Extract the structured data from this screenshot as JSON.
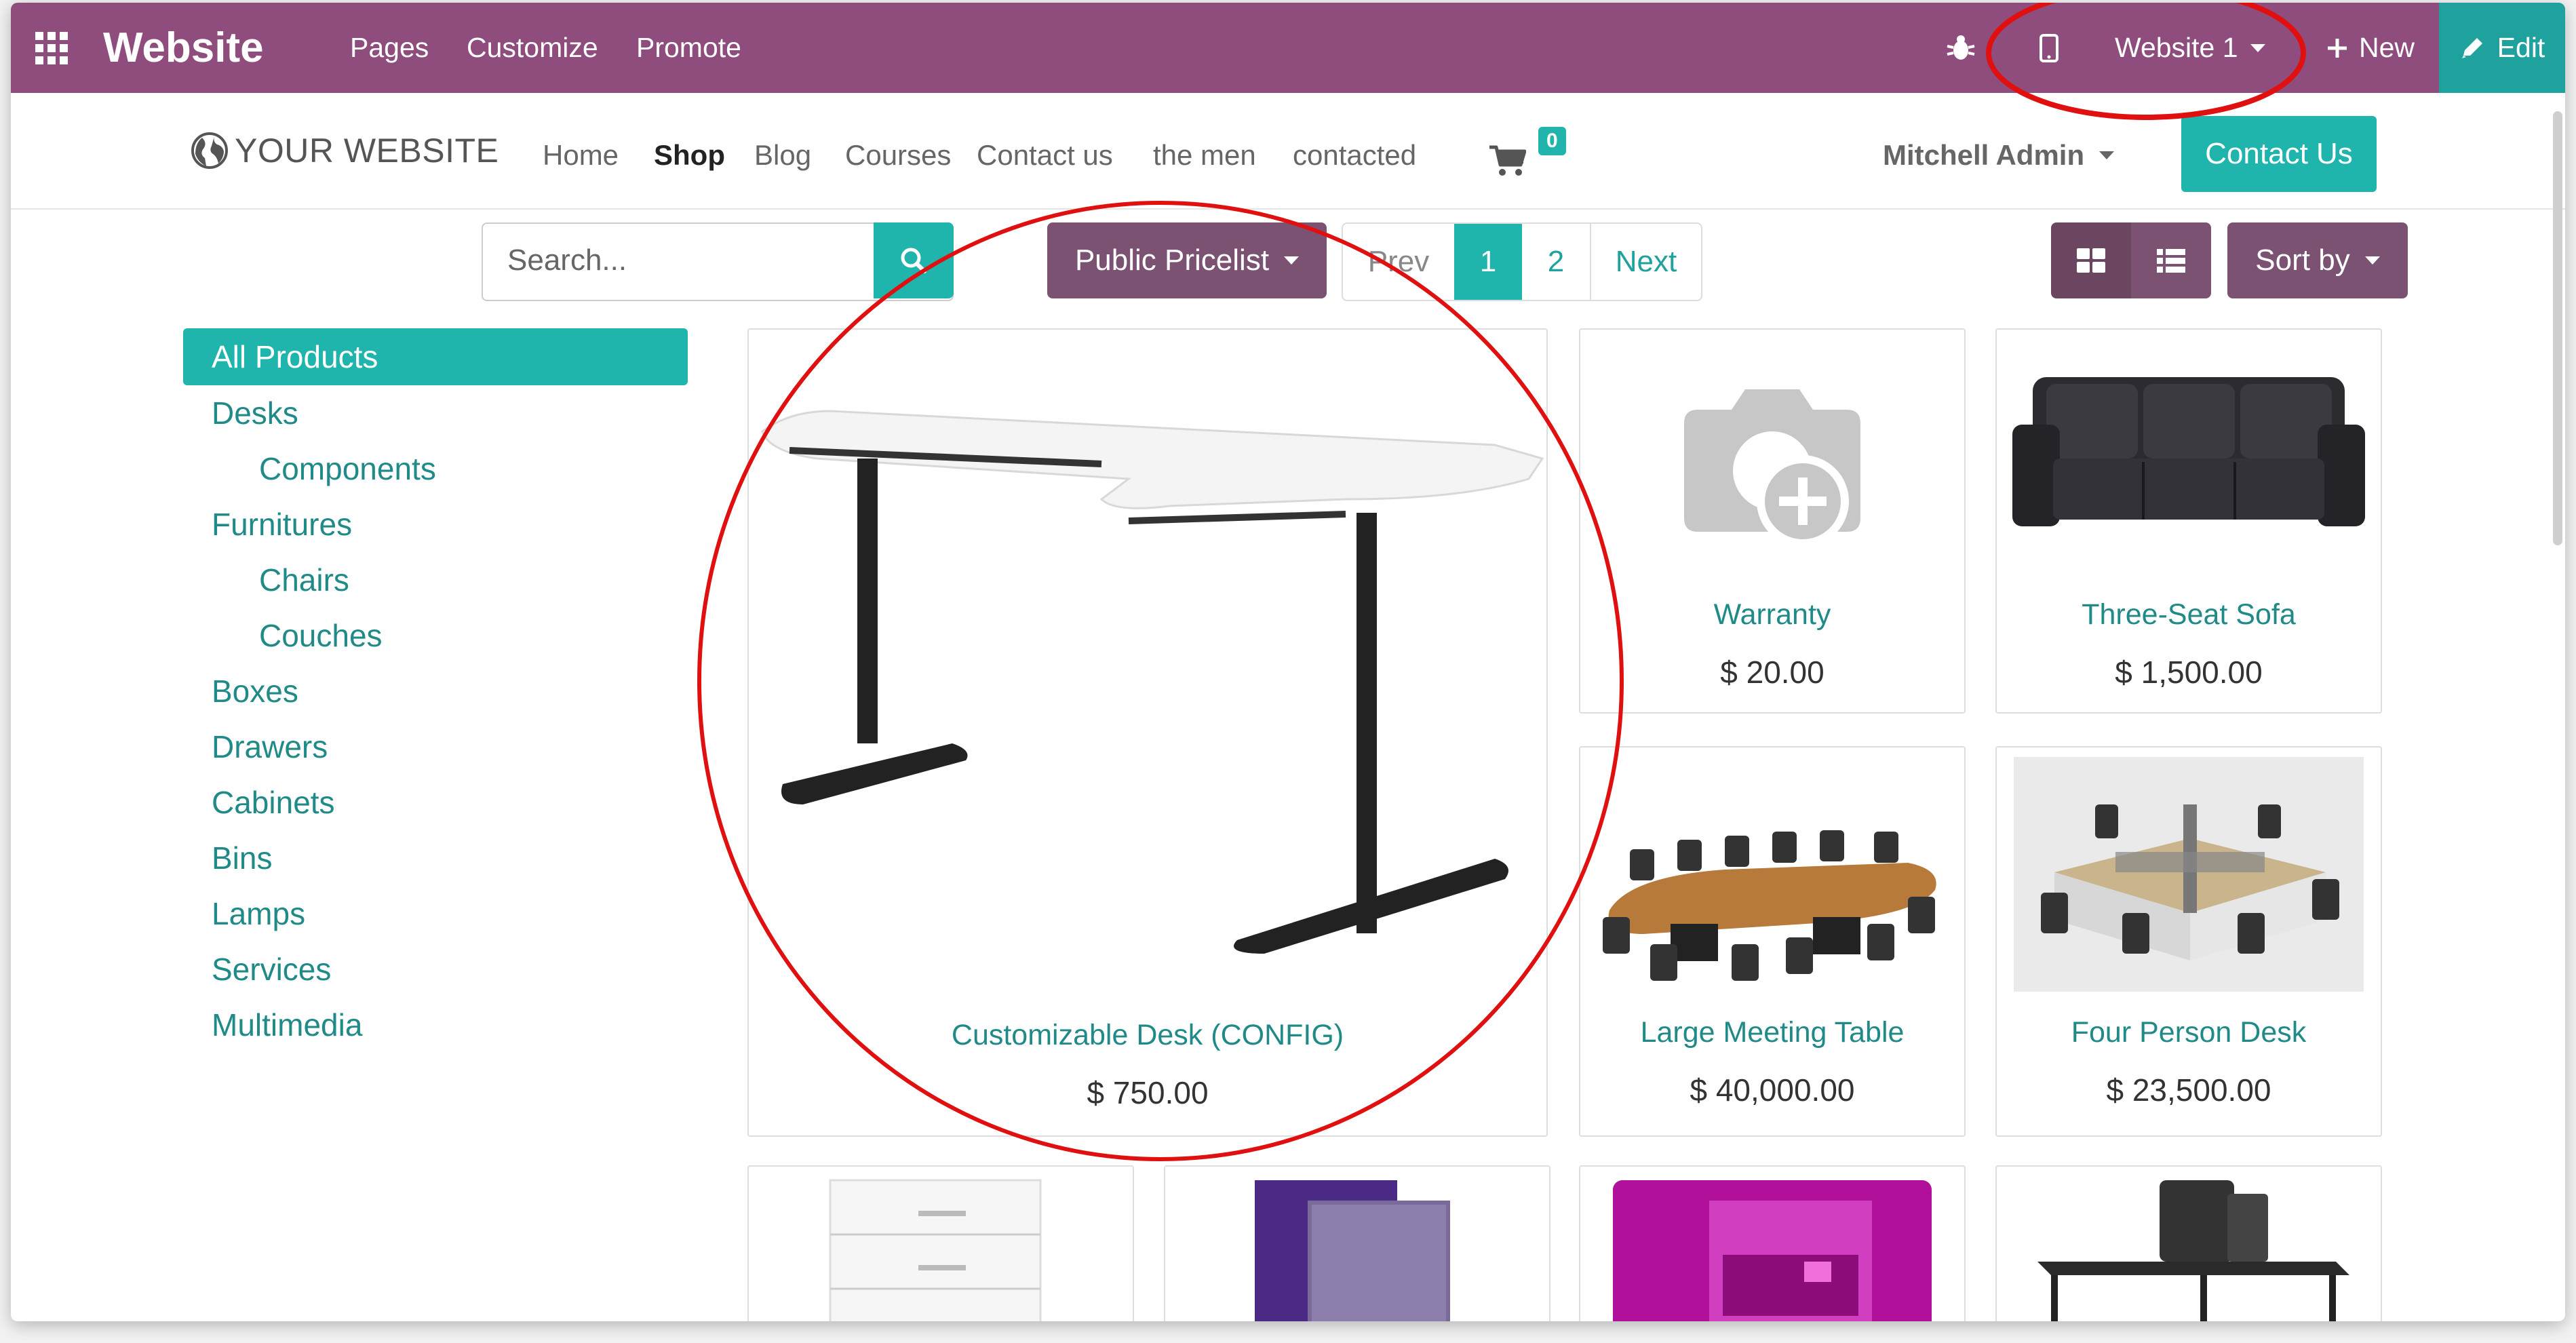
{
  "topbar": {
    "app_title": "Website",
    "menu": [
      "Pages",
      "Customize",
      "Promote"
    ],
    "website_selector": "Website 1",
    "new_label": "New",
    "edit_label": "Edit",
    "color": "#8e4d7c"
  },
  "site": {
    "logo_text": "YOUR WEBSITE",
    "nav": [
      "Home",
      "Shop",
      "Blog",
      "Courses",
      "Contact us",
      "the men",
      "contacted"
    ],
    "active_nav": "Shop",
    "cart_count": "0",
    "user": "Mitchell Admin",
    "contact_button": "Contact Us",
    "accent": "#1fb5ac"
  },
  "toolbar": {
    "search_placeholder": "Search...",
    "pricelist": "Public Pricelist",
    "pager": {
      "prev": "Prev",
      "pages": [
        "1",
        "2"
      ],
      "current": "1",
      "next": "Next"
    },
    "sort_label": "Sort by"
  },
  "categories": {
    "active": "All Products",
    "items": [
      {
        "label": "Desks",
        "level": 0
      },
      {
        "label": "Components",
        "level": 1
      },
      {
        "label": "Furnitures",
        "level": 0
      },
      {
        "label": "Chairs",
        "level": 1
      },
      {
        "label": "Couches",
        "level": 1
      },
      {
        "label": "Boxes",
        "level": 0
      },
      {
        "label": "Drawers",
        "level": 0
      },
      {
        "label": "Cabinets",
        "level": 0
      },
      {
        "label": "Bins",
        "level": 0
      },
      {
        "label": "Lamps",
        "level": 0
      },
      {
        "label": "Services",
        "level": 0
      },
      {
        "label": "Multimedia",
        "level": 0
      }
    ]
  },
  "products": [
    {
      "name": "Customizable Desk (CONFIG)",
      "price": "$ 750.00"
    },
    {
      "name": "Warranty",
      "price": "$ 20.00"
    },
    {
      "name": "Three-Seat Sofa",
      "price": "$ 1,500.00"
    },
    {
      "name": "Large Meeting Table",
      "price": "$ 40,000.00"
    },
    {
      "name": "Four Person Desk",
      "price": "$ 23,500.00"
    }
  ],
  "annotation_color": "#e01010"
}
